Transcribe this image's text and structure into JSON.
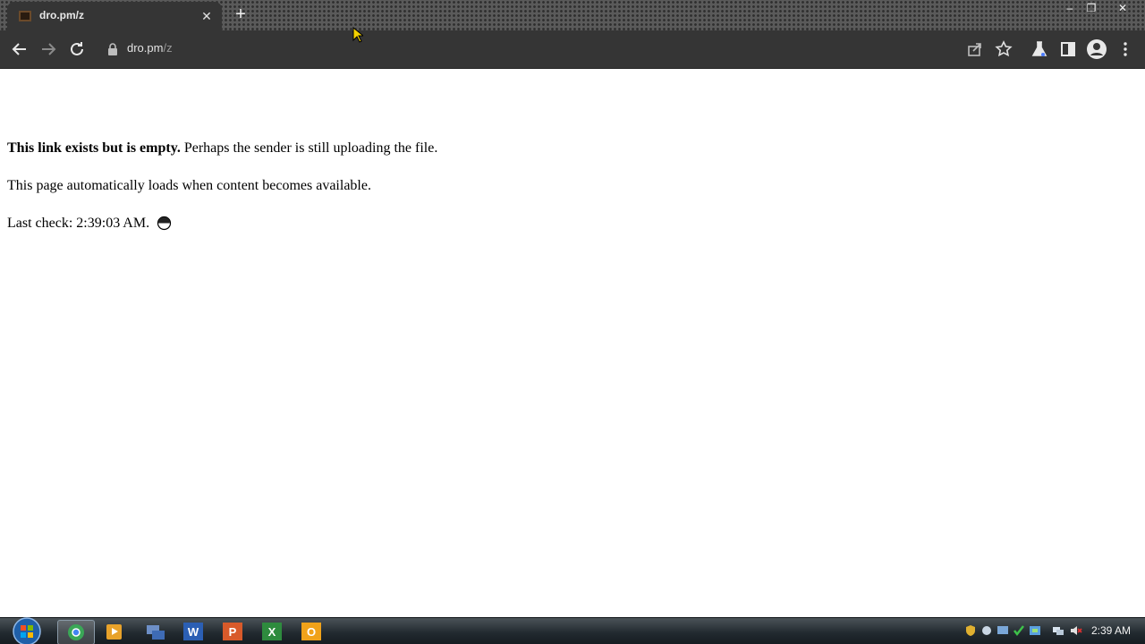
{
  "browser": {
    "tab_title": "dro.pm/z",
    "url_host": "dro.pm",
    "url_path": "/z"
  },
  "page": {
    "line1_bold": "This link exists but is empty.",
    "line1_rest": " Perhaps the sender is still uploading the file.",
    "line2": "This page automatically loads when content becomes available.",
    "line3": "Last check: 2:39:03 AM."
  },
  "taskbar": {
    "apps": [
      "chrome-icon",
      "media-player-icon",
      "network-icon",
      "word-icon",
      "powerpoint-icon",
      "excel-icon",
      "outlook-icon"
    ],
    "clock": "2:39 AM"
  }
}
